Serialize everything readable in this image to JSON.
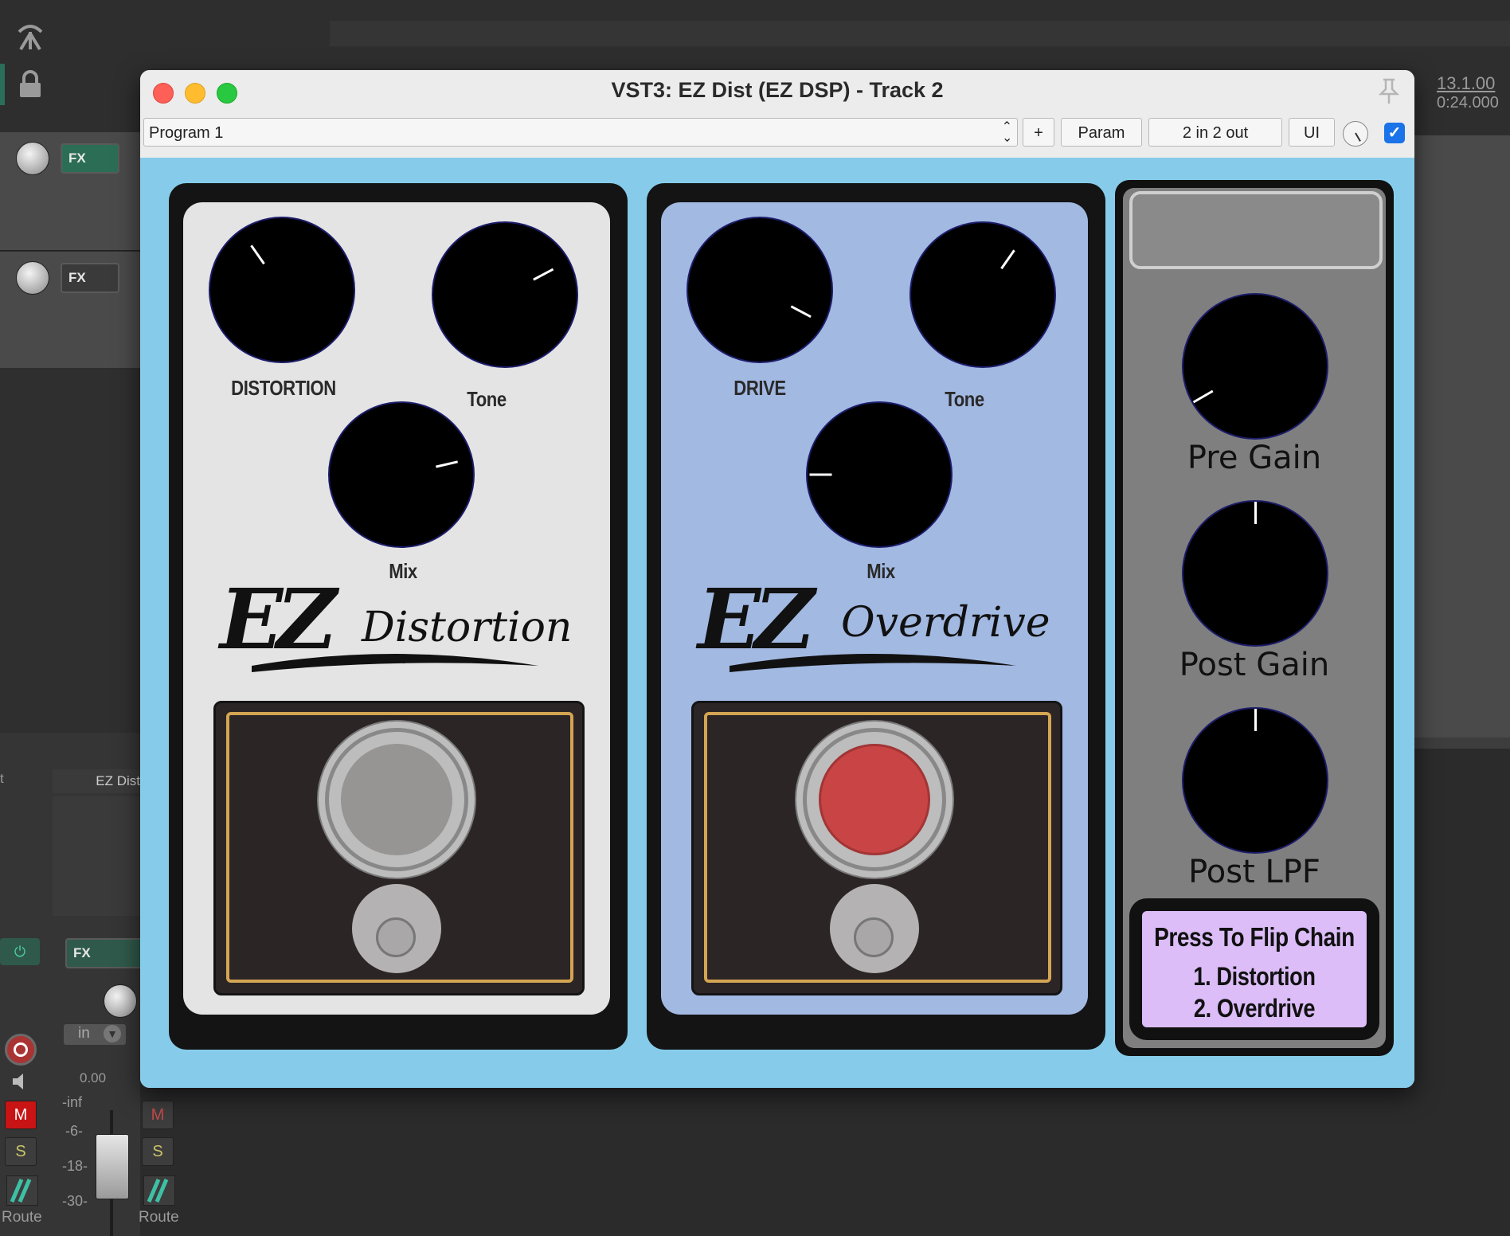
{
  "window": {
    "title": "VST3: EZ Dist (EZ DSP) - Track 2"
  },
  "toolbar": {
    "preset": "Program 1",
    "add_label": "+",
    "param_label": "Param",
    "io_label": "2 in 2 out",
    "ui_label": "UI",
    "enabled": true
  },
  "pedals": [
    {
      "name": "distortion",
      "knob_labels": [
        "DISTORTION",
        "Tone",
        "Mix"
      ],
      "logo_ez": "EZ",
      "logo_word": "Distortion",
      "active": false,
      "body_color": "#e4e4e4"
    },
    {
      "name": "overdrive",
      "knob_labels": [
        "DRIVE",
        "Tone",
        "Mix"
      ],
      "logo_ez": "EZ",
      "logo_word": "Overdrive",
      "active": true,
      "body_color": "#a2b9e2"
    }
  ],
  "right_panel": {
    "knob_labels": [
      "Pre Gain",
      "Post Gain",
      "Post LPF"
    ],
    "flip_title": "Press To Flip Chain",
    "chain_1": "1. Distortion",
    "chain_2": "2. Overdrive"
  },
  "daw": {
    "time_bar": "13.1.00",
    "time_sec": "0:24.000",
    "track_name": "EZ Dist",
    "fx_label": "FX",
    "input_label": "in",
    "volume": "0.00",
    "meter_inf": "-inf",
    "meter_6": "-6-",
    "meter_18": "-18-",
    "meter_30": "-30-",
    "mute_label": "M",
    "solo_label": "S",
    "route_label": "Route",
    "track_prefix": "t"
  },
  "colors": {
    "plugin_bg": "#86ccea",
    "switch_active": "#c94444",
    "flip_panel": "#dcbdf8",
    "mute_active": "#c81414"
  }
}
